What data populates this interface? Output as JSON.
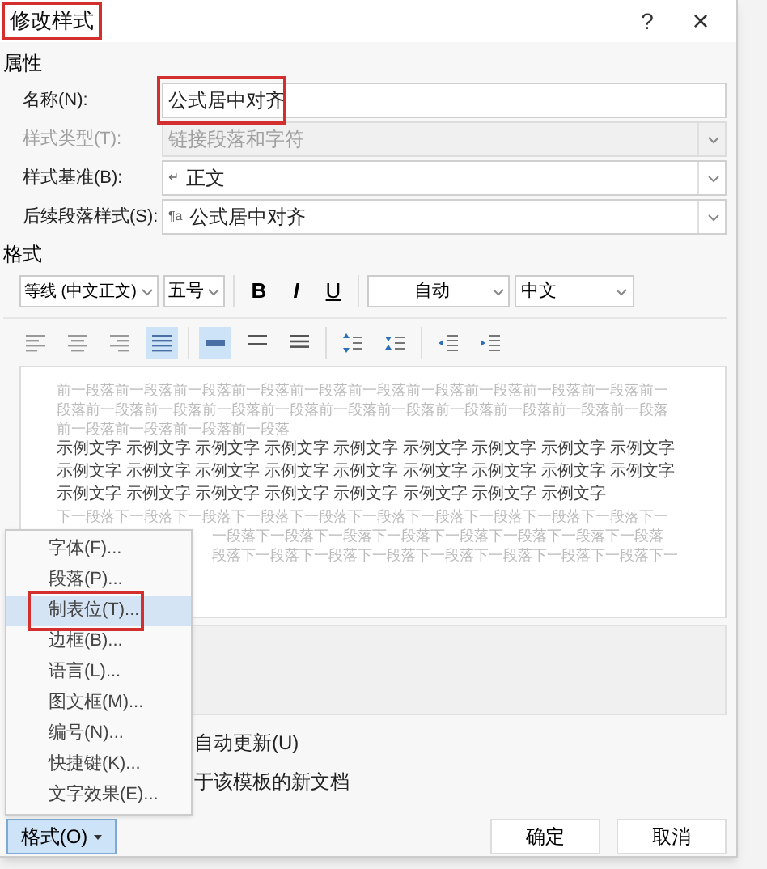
{
  "window": {
    "title": "修改样式",
    "title_highlighted": true,
    "help": "?",
    "close": "×"
  },
  "properties": {
    "heading": "属性",
    "rows": [
      {
        "kind": "text",
        "label": "名称(N):",
        "value": "公式居中对齐",
        "disabled": false,
        "highlighted": true
      },
      {
        "kind": "select",
        "label": "样式类型(T):",
        "value": "链接段落和字符",
        "disabled": true
      },
      {
        "kind": "select",
        "label": "样式基准(B):",
        "value": "正文",
        "mark": "↵",
        "disabled": false
      },
      {
        "kind": "select",
        "label": "后续段落样式(S):",
        "value": "公式居中对齐",
        "mark": "¶a",
        "disabled": false
      }
    ]
  },
  "format": {
    "heading": "格式",
    "font": "等线 (中文正文)",
    "size": "五号",
    "bold": "B",
    "italic": "I",
    "underline": "U",
    "color_text": "自动",
    "language": "中文",
    "alignment": [
      {
        "kind": "left",
        "selected": false
      },
      {
        "kind": "center",
        "selected": false
      },
      {
        "kind": "right",
        "selected": false
      },
      {
        "kind": "justify",
        "selected": true
      }
    ],
    "spacing": [
      {
        "kind": "single",
        "selected": true
      },
      {
        "kind": "one-half",
        "selected": false
      },
      {
        "kind": "double",
        "selected": false
      }
    ],
    "paragraph_spacing": [
      {
        "kind": "increase"
      },
      {
        "kind": "decrease"
      }
    ],
    "indent": [
      {
        "kind": "decrease"
      },
      {
        "kind": "increase"
      }
    ]
  },
  "preview": {
    "previous": [
      "前一段落前一段落前一段落前一段落前一段落前一段落前一段落前一段落前一段落前一段落前一",
      "段落前一段落前一段落前一段落前一段落前一段落前一段落前一段落前一段落前一段落前一段落",
      "前一段落前一段落前一段落前一段落"
    ],
    "sample": [
      "示例文字 示例文字 示例文字 示例文字 示例文字 示例文字 示例文字 示例文字 示例文字",
      "示例文字 示例文字 示例文字 示例文字 示例文字 示例文字 示例文字 示例文字 示例文字",
      "示例文字 示例文字 示例文字 示例文字 示例文字 示例文字 示例文字 示例文字"
    ],
    "next": [
      {
        "text": "下一段落下一段落下一段落下一段落下一段落下一段落下一段落下一段落下一段落下一段落下一",
        "covered": false
      },
      {
        "text": "一段落下一段落下一段落下一段落下一段落下一段落下一段落下一段落",
        "covered": true
      },
      {
        "text": "段落下一段落下一段落下一段落下一段落下一段落下一段落下一段落下一",
        "covered": true
      }
    ]
  },
  "options": [
    {
      "label": "自动更新(U)"
    },
    {
      "label": "于该模板的新文档"
    }
  ],
  "buttons": {
    "format": "格式(O)",
    "ok": "确定",
    "cancel": "取消"
  },
  "menu": {
    "items": [
      {
        "label": "字体(F)...",
        "selected": false,
        "highlighted": false
      },
      {
        "label": "段落(P)...",
        "selected": false,
        "highlighted": false
      },
      {
        "label": "制表位(T)...",
        "selected": true,
        "highlighted": true
      },
      {
        "label": "边框(B)...",
        "selected": false,
        "highlighted": false
      },
      {
        "label": "语言(L)...",
        "selected": false,
        "highlighted": false
      },
      {
        "label": "图文框(M)...",
        "selected": false,
        "highlighted": false
      },
      {
        "label": "编号(N)...",
        "selected": false,
        "highlighted": false
      },
      {
        "label": "快捷键(K)...",
        "selected": false,
        "highlighted": false
      },
      {
        "label": "文字效果(E)...",
        "selected": false,
        "highlighted": false
      }
    ]
  }
}
